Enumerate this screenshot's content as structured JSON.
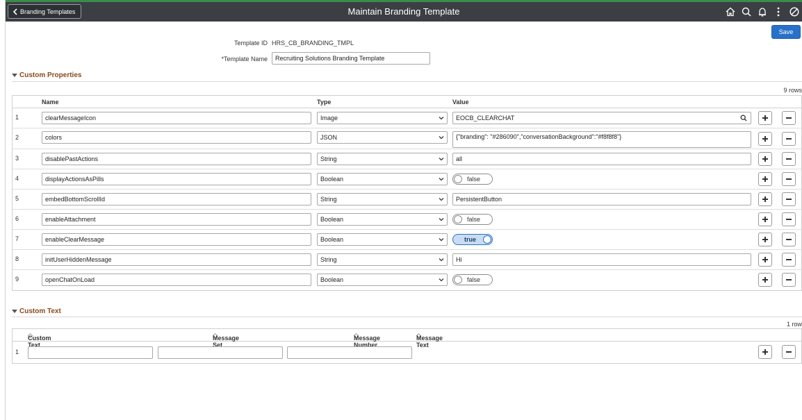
{
  "header": {
    "back_label": "Branding Templates",
    "title": "Maintain Branding Template",
    "icons": [
      "home-icon",
      "search-icon",
      "bell-icon",
      "more-icon",
      "block-icon"
    ]
  },
  "toolbar": {
    "save_label": "Save"
  },
  "form": {
    "template_id_label": "Template ID",
    "template_id_value": "HRS_CB_BRANDING_TMPL",
    "template_name_label": "*Template Name",
    "template_name_value": "Recruiting Solutions Branding Template"
  },
  "custom_properties": {
    "section_label": "Custom Properties",
    "row_count": "9 rows",
    "columns": {
      "name": "Name",
      "type": "Type",
      "value": "Value"
    },
    "rows": [
      {
        "num": "1",
        "name": "clearMessageIcon",
        "type": "Image",
        "value": "EOCB_CLEARCHAT"
      },
      {
        "num": "2",
        "name": "colors",
        "type": "JSON",
        "value": "{\"branding\": \"#286090\",\"conversationBackground\":\"#f8f8f8\"}"
      },
      {
        "num": "3",
        "name": "disablePastActions",
        "type": "String",
        "value": "all"
      },
      {
        "num": "4",
        "name": "displayActionsAsPills",
        "type": "Boolean",
        "value": "false"
      },
      {
        "num": "5",
        "name": "embedBottomScrollId",
        "type": "String",
        "value": "PersistentButton"
      },
      {
        "num": "6",
        "name": "enableAttachment",
        "type": "Boolean",
        "value": "false"
      },
      {
        "num": "7",
        "name": "enableClearMessage",
        "type": "Boolean",
        "value": "true"
      },
      {
        "num": "8",
        "name": "initUserHiddenMessage",
        "type": "String",
        "value": "Hi"
      },
      {
        "num": "9",
        "name": "openChatOnLoad",
        "type": "Boolean",
        "value": "false"
      }
    ]
  },
  "custom_text": {
    "section_label": "Custom Text",
    "row_count": "1 row",
    "columns": {
      "custom_text": "Custom Text",
      "message_set_number": "Message Set Number",
      "message_number": "Message Number",
      "message_text": "Message Text"
    },
    "rows": [
      {
        "num": "1",
        "custom_text": "",
        "message_set_number": "",
        "message_number": ""
      }
    ]
  },
  "colors": {
    "header_bg": "#3b3f44",
    "accent": "#2871c9",
    "section": "#8a4a19"
  }
}
